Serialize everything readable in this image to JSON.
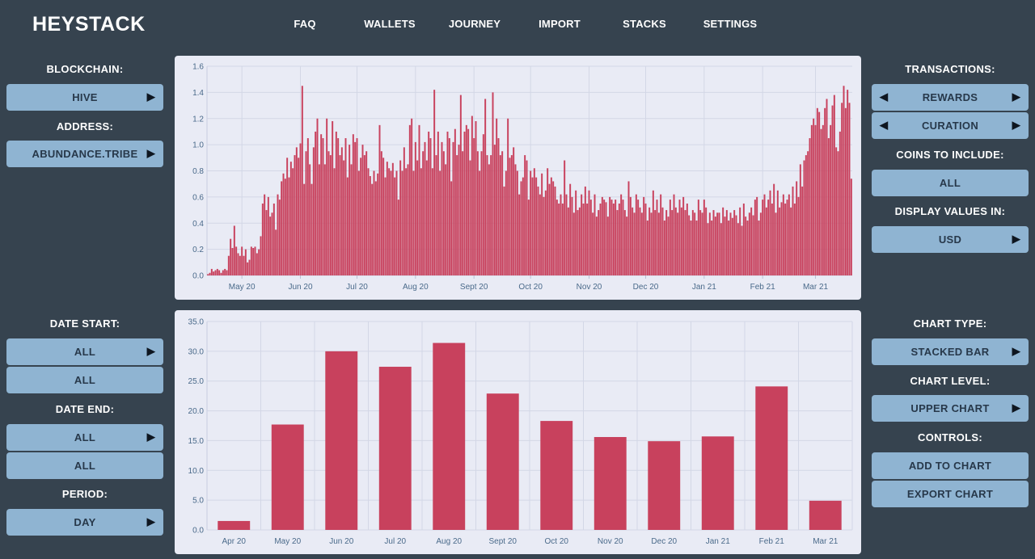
{
  "header": {
    "logo": "HEYSTACK",
    "nav": [
      "FAQ",
      "WALLETS",
      "JOURNEY",
      "IMPORT",
      "STACKS",
      "SETTINGS"
    ]
  },
  "left_panel": {
    "blockchain_label": "BLOCKCHAIN:",
    "blockchain_value": "HIVE",
    "address_label": "ADDRESS:",
    "address_value": "ABUNDANCE.TRIBE",
    "date_start_label": "DATE START:",
    "date_start_value": "ALL",
    "date_start_sub": "ALL",
    "date_end_label": "DATE END:",
    "date_end_value": "ALL",
    "date_end_sub": "ALL",
    "period_label": "PERIOD:",
    "period_value": "DAY"
  },
  "right_panel": {
    "transactions_label": "TRANSACTIONS:",
    "transactions_value1": "REWARDS",
    "transactions_value2": "CURATION",
    "coins_label": "COINS TO INCLUDE:",
    "coins_value": "ALL",
    "display_label": "DISPLAY VALUES IN:",
    "display_value": "USD",
    "chart_type_label": "CHART TYPE:",
    "chart_type_value": "STACKED BAR",
    "chart_level_label": "CHART LEVEL:",
    "chart_level_value": "UPPER CHART",
    "controls_label": "CONTROLS:",
    "add_to_chart": "ADD TO CHART",
    "export_chart": "EXPORT CHART"
  },
  "colors": {
    "bar": "#c8415d",
    "panel_bg": "#e9ebf5",
    "button_bg": "#8fb4d2",
    "page_bg": "#36434f"
  },
  "chart_data": [
    {
      "type": "bar",
      "x_ticks": [
        "May 20",
        "Jun 20",
        "Jul 20",
        "Aug 20",
        "Sept 20",
        "Oct 20",
        "Nov 20",
        "Dec 20",
        "Jan 21",
        "Feb 21",
        "Mar 21"
      ],
      "y_ticks": [
        "0.0",
        "0.2",
        "0.4",
        "0.6",
        "0.8",
        "1.0",
        "1.2",
        "1.4",
        "1.6"
      ],
      "ylim": [
        0,
        1.6
      ],
      "x_start": "2020-04-13",
      "values": [
        0.01,
        0.02,
        0.05,
        0.03,
        0.04,
        0.05,
        0.04,
        0.02,
        0.04,
        0.05,
        0.04,
        0.15,
        0.28,
        0.21,
        0.38,
        0.22,
        0.17,
        0.15,
        0.22,
        0.15,
        0.2,
        0.1,
        0.12,
        0.22,
        0.21,
        0.22,
        0.17,
        0.2,
        0.3,
        0.55,
        0.62,
        0.5,
        0.6,
        0.45,
        0.48,
        0.55,
        0.35,
        0.62,
        0.58,
        0.72,
        0.78,
        0.74,
        0.9,
        0.75,
        0.87,
        0.82,
        0.92,
        0.98,
        0.9,
        1.01,
        1.45,
        0.7,
        0.95,
        1.05,
        0.85,
        0.7,
        0.98,
        1.1,
        1.2,
        0.85,
        1.08,
        1.05,
        0.85,
        1.2,
        0.95,
        0.92,
        1.18,
        0.82,
        1.1,
        1.05,
        0.92,
        0.98,
        0.88,
        1.05,
        0.75,
        1.0,
        0.85,
        1.08,
        1.02,
        1.05,
        0.8,
        0.9,
        1.0,
        0.92,
        0.95,
        0.82,
        0.76,
        0.7,
        0.8,
        0.72,
        0.78,
        1.15,
        0.95,
        0.9,
        0.75,
        0.87,
        0.82,
        0.8,
        0.86,
        0.75,
        0.8,
        0.58,
        0.88,
        0.8,
        0.98,
        0.82,
        0.85,
        1.15,
        1.2,
        0.8,
        1.02,
        0.88,
        1.15,
        0.82,
        0.95,
        1.02,
        0.88,
        1.1,
        1.05,
        0.82,
        1.42,
        0.92,
        1.1,
        0.8,
        1.02,
        0.95,
        0.85,
        1.1,
        1.05,
        0.72,
        1.02,
        1.12,
        0.92,
        1.0,
        1.38,
        0.95,
        1.1,
        1.15,
        1.12,
        0.88,
        1.22,
        1.05,
        1.18,
        0.95,
        0.8,
        0.95,
        1.08,
        1.35,
        0.92,
        0.85,
        0.92,
        1.4,
        1.0,
        1.2,
        1.05,
        0.92,
        0.95,
        0.68,
        0.8,
        1.2,
        0.9,
        0.92,
        0.98,
        0.85,
        0.8,
        0.62,
        0.72,
        0.75,
        0.92,
        0.88,
        0.58,
        0.8,
        0.75,
        0.82,
        0.75,
        0.68,
        0.62,
        0.78,
        0.6,
        0.65,
        0.82,
        0.7,
        0.75,
        0.72,
        0.68,
        0.58,
        0.55,
        0.62,
        0.55,
        0.88,
        0.62,
        0.52,
        0.7,
        0.6,
        0.48,
        0.65,
        0.5,
        0.52,
        0.62,
        0.55,
        0.68,
        0.55,
        0.65,
        0.58,
        0.48,
        0.62,
        0.45,
        0.5,
        0.55,
        0.6,
        0.58,
        0.56,
        0.45,
        0.6,
        0.58,
        0.55,
        0.58,
        0.5,
        0.55,
        0.62,
        0.58,
        0.5,
        0.45,
        0.72,
        0.6,
        0.52,
        0.48,
        0.62,
        0.58,
        0.52,
        0.48,
        0.6,
        0.55,
        0.42,
        0.52,
        0.48,
        0.65,
        0.5,
        0.58,
        0.48,
        0.62,
        0.52,
        0.42,
        0.5,
        0.45,
        0.58,
        0.5,
        0.62,
        0.52,
        0.48,
        0.58,
        0.52,
        0.6,
        0.5,
        0.55,
        0.46,
        0.42,
        0.5,
        0.48,
        0.42,
        0.58,
        0.5,
        0.48,
        0.58,
        0.52,
        0.4,
        0.48,
        0.42,
        0.5,
        0.45,
        0.48,
        0.48,
        0.4,
        0.52,
        0.45,
        0.5,
        0.42,
        0.48,
        0.44,
        0.5,
        0.46,
        0.4,
        0.52,
        0.38,
        0.55,
        0.45,
        0.42,
        0.48,
        0.52,
        0.46,
        0.58,
        0.6,
        0.42,
        0.48,
        0.58,
        0.62,
        0.52,
        0.58,
        0.65,
        0.55,
        0.7,
        0.48,
        0.65,
        0.52,
        0.56,
        0.62,
        0.55,
        0.58,
        0.62,
        0.52,
        0.68,
        0.55,
        0.72,
        0.6,
        0.85,
        0.68,
        0.88,
        0.92,
        0.95,
        1.05,
        1.15,
        1.2,
        1.15,
        1.28,
        1.25,
        1.12,
        1.15,
        1.28,
        1.35,
        1.05,
        1.15,
        1.3,
        1.38,
        0.98,
        0.95,
        1.1,
        1.32,
        1.45,
        1.28,
        1.42,
        1.32,
        0.74
      ]
    },
    {
      "type": "bar",
      "categories": [
        "Apr 20",
        "May 20",
        "Jun 20",
        "Jul 20",
        "Aug 20",
        "Sept 20",
        "Oct 20",
        "Nov 20",
        "Dec 20",
        "Jan 21",
        "Feb 21",
        "Mar 21"
      ],
      "values": [
        1.5,
        17.7,
        30.0,
        27.4,
        31.4,
        22.9,
        18.3,
        15.6,
        14.9,
        15.7,
        24.1,
        4.9
      ],
      "y_ticks": [
        "0.0",
        "5.0",
        "10.0",
        "15.0",
        "20.0",
        "25.0",
        "30.0",
        "35.0"
      ],
      "ylim": [
        0,
        35
      ]
    }
  ]
}
